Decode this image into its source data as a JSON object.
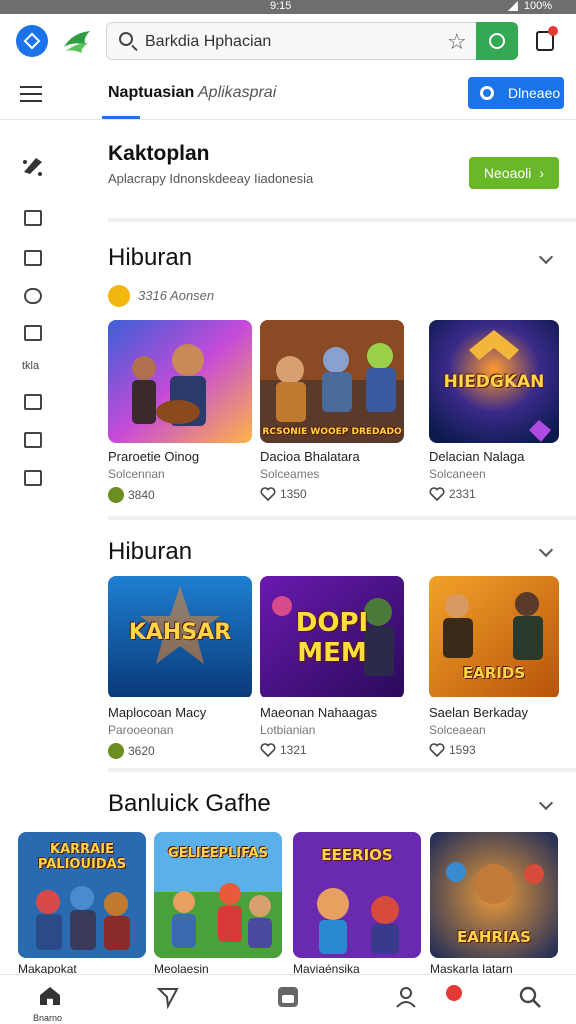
{
  "status": {
    "time": "9:15",
    "battery": "100%"
  },
  "browser": {
    "query": "Barkdia Hphacian",
    "icons": [
      "app-icon",
      "brand-logo-icon",
      "search-icon",
      "star-icon",
      "go-icon",
      "cast-icon"
    ]
  },
  "topbar": {
    "tab_active": "Naptuasian",
    "tab_inactive": "Aplikasprai",
    "button_label": "Dlneaeo"
  },
  "side_rail": {
    "label": "tkla"
  },
  "promo": {
    "title": "Kaktoplan",
    "subtitle": "Aplacrapy Idnonskdeeay Iiadonesia",
    "button_label": "Neoaoli"
  },
  "section1": {
    "title": "Hiburan",
    "coin_text": "3316 Aonsen",
    "cards": [
      {
        "title": "Praroetie Oinog",
        "sub": "Solcennan",
        "meta": "3840",
        "thumb_text": ""
      },
      {
        "title": "Dacioa Bhalatara",
        "sub": "Solceames",
        "meta": "1350",
        "thumb_text": "RCSONIE WOOEP DREDADO"
      },
      {
        "title": "Delacian Nalaga",
        "sub": "Solcaneen",
        "meta": "2331",
        "thumb_text": "HIEDGKAN"
      }
    ]
  },
  "section2": {
    "title": "Hiburan",
    "cards": [
      {
        "title": "Maplocoan Macy",
        "sub": "Parooeonan",
        "meta": "3620",
        "thumb_text": "KAHSAR"
      },
      {
        "title": "Maeonan Nahaagas",
        "sub": "Lotbianian",
        "meta": "1321",
        "thumb_text": "DOPI MEM"
      },
      {
        "title": "Saelan Berkaday",
        "sub": "Solceaean",
        "meta": "1593",
        "thumb_text": "EARIDS"
      }
    ]
  },
  "section3": {
    "title": "Banluick Gafhe",
    "cards": [
      {
        "title": "Makapokat",
        "thumb_text": "KARRAIE PALIOUIDAS"
      },
      {
        "title": "Meolaesin",
        "thumb_text": "GELIEEPLIFAS"
      },
      {
        "title": "Maviaénsika",
        "thumb_text": "EEERIOS"
      },
      {
        "title": "Maskarla Iatarn",
        "thumb_text": "EAHRIAS"
      }
    ]
  },
  "bottom_nav": {
    "home_label": "Bnarno",
    "icons": [
      "home-icon",
      "send-icon",
      "store-icon",
      "profile-icon",
      "search-icon"
    ]
  },
  "colors": {
    "accent_blue": "#1a73e8",
    "accent_green": "#6ab72a",
    "badge_red": "#e53935"
  }
}
